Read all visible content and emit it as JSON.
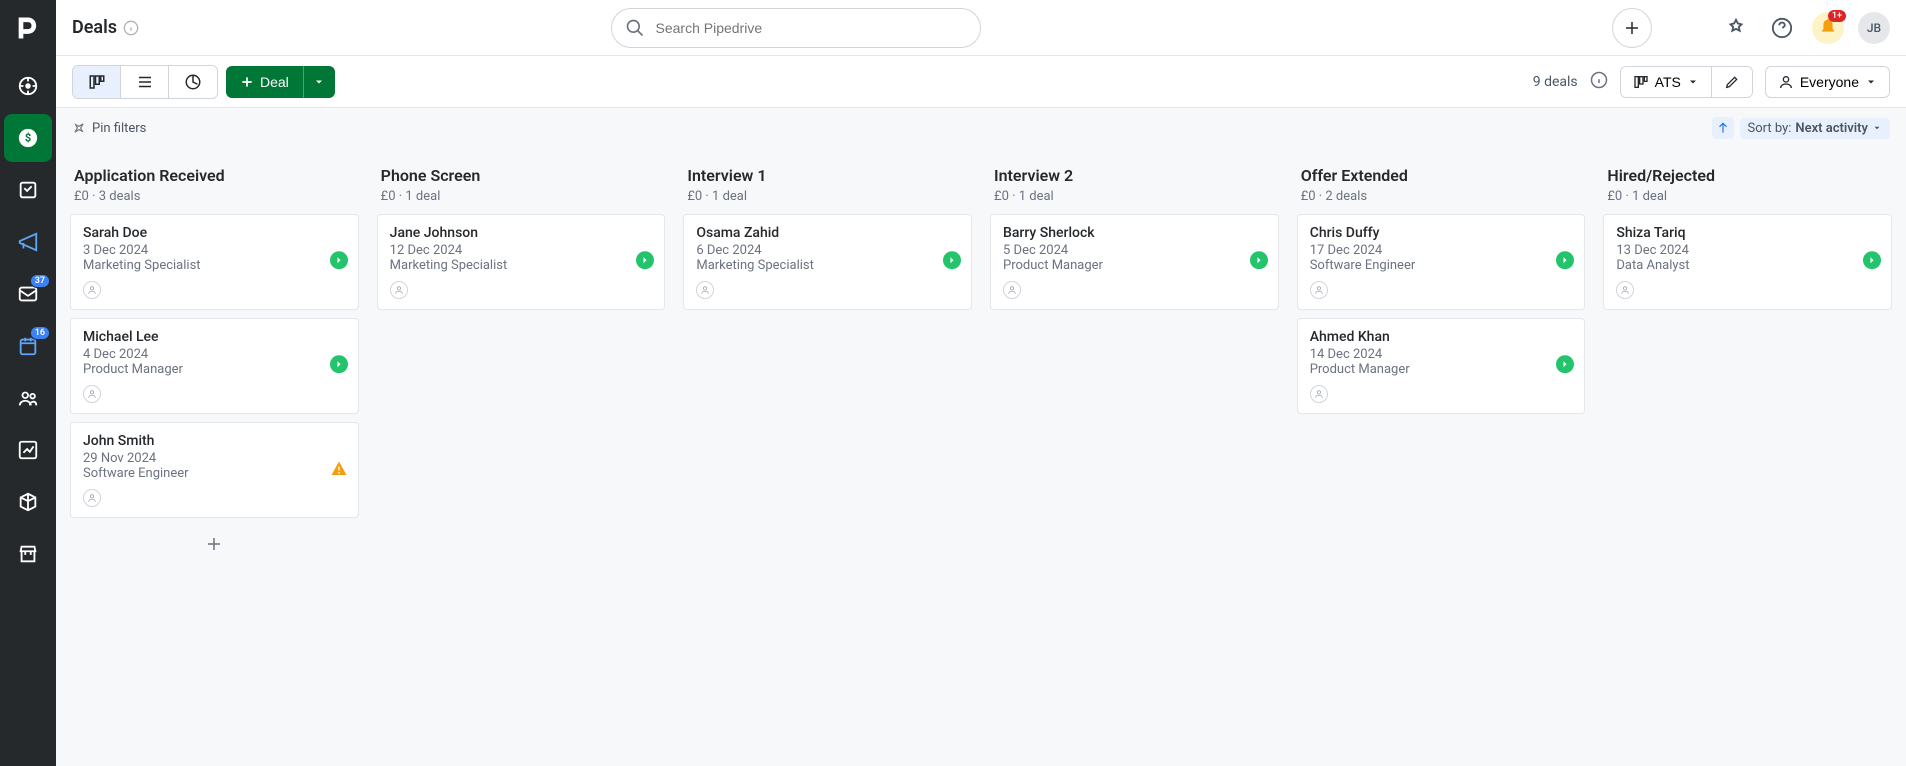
{
  "header": {
    "title": "Deals",
    "search_placeholder": "Search Pipedrive",
    "notif_count": "1+",
    "avatar_initials": "JB"
  },
  "sidebar": {
    "badges": {
      "leads": "37",
      "activities": "16"
    }
  },
  "toolbar": {
    "deal_label": "Deal",
    "deal_count": "9 deals",
    "pipeline": "ATS",
    "everyone": "Everyone"
  },
  "filters": {
    "pin": "Pin filters",
    "sort_prefix": "Sort by: ",
    "sort_value": "Next activity"
  },
  "columns": [
    {
      "title": "Application Received",
      "meta": "£0 · 3 deals",
      "cards": [
        {
          "name": "Sarah Doe",
          "date": "3 Dec 2024",
          "role": "Marketing Specialist",
          "status": "ok"
        },
        {
          "name": "Michael Lee",
          "date": "4 Dec 2024",
          "role": "Product Manager",
          "status": "ok"
        },
        {
          "name": "John Smith",
          "date": "29 Nov 2024",
          "role": "Software Engineer",
          "status": "warn"
        }
      ],
      "show_add": true
    },
    {
      "title": "Phone Screen",
      "meta": "£0 · 1 deal",
      "cards": [
        {
          "name": "Jane Johnson",
          "date": "12 Dec 2024",
          "role": "Marketing Specialist",
          "status": "ok"
        }
      ]
    },
    {
      "title": "Interview 1",
      "meta": "£0 · 1 deal",
      "cards": [
        {
          "name": "Osama Zahid",
          "date": "6 Dec 2024",
          "role": "Marketing Specialist",
          "status": "ok"
        }
      ]
    },
    {
      "title": "Interview 2",
      "meta": "£0 · 1 deal",
      "cards": [
        {
          "name": "Barry Sherlock",
          "date": "5 Dec 2024",
          "role": "Product Manager",
          "status": "ok"
        }
      ]
    },
    {
      "title": "Offer Extended",
      "meta": "£0 · 2 deals",
      "cards": [
        {
          "name": "Chris Duffy",
          "date": "17 Dec 2024",
          "role": "Software Engineer",
          "status": "ok"
        },
        {
          "name": "Ahmed Khan",
          "date": "14 Dec 2024",
          "role": "Product Manager",
          "status": "ok"
        }
      ]
    },
    {
      "title": "Hired/Rejected",
      "meta": "£0 · 1 deal",
      "cards": [
        {
          "name": "Shiza Tariq",
          "date": "13 Dec 2024",
          "role": "Data Analyst",
          "status": "ok"
        }
      ]
    }
  ]
}
